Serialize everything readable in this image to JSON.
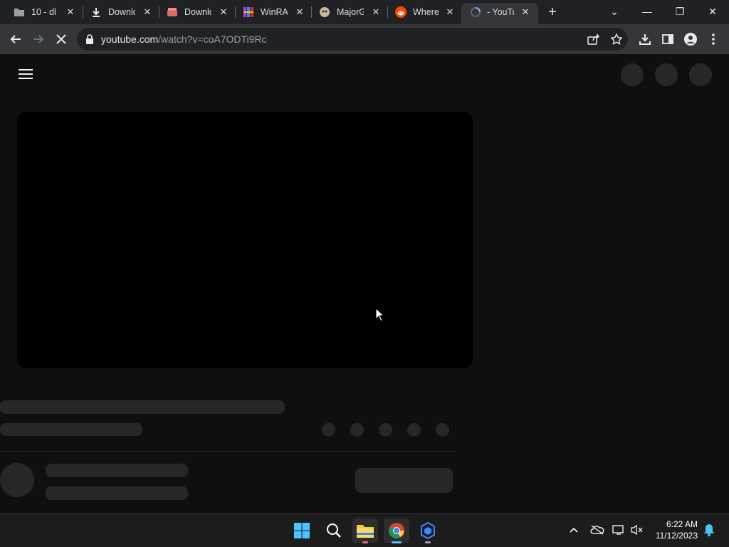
{
  "browser": {
    "tabs": [
      {
        "label": "10 - dl",
        "icon": "folder-icon"
      },
      {
        "label": "Downlo",
        "icon": "download-icon"
      },
      {
        "label": "Downlo",
        "icon": "store-icon"
      },
      {
        "label": "WinRAI",
        "icon": "winrar-icon"
      },
      {
        "label": "MajorG",
        "icon": "majorgeeks-icon"
      },
      {
        "label": "Where",
        "icon": "reddit-icon"
      },
      {
        "label": "- YouTu",
        "icon": "loading-icon",
        "active": true
      }
    ],
    "new_tab_symbol": "+",
    "window_controls": {
      "tab_search": "⌄",
      "minimize": "—",
      "restore": "❐",
      "close": "✕"
    },
    "address": {
      "domain": "youtube.com",
      "path": "/watch?v=coA7ODTi9Rc"
    }
  },
  "taskbar": {
    "clock": {
      "time": "6:22 AM",
      "date": "11/12/2023"
    }
  },
  "colors": {
    "page_bg": "#0f0f0f",
    "skeleton": "#272727",
    "chrome_toolbar": "#35363a",
    "chrome_tabstrip": "#202124",
    "taskbar": "#1c1c1c"
  }
}
